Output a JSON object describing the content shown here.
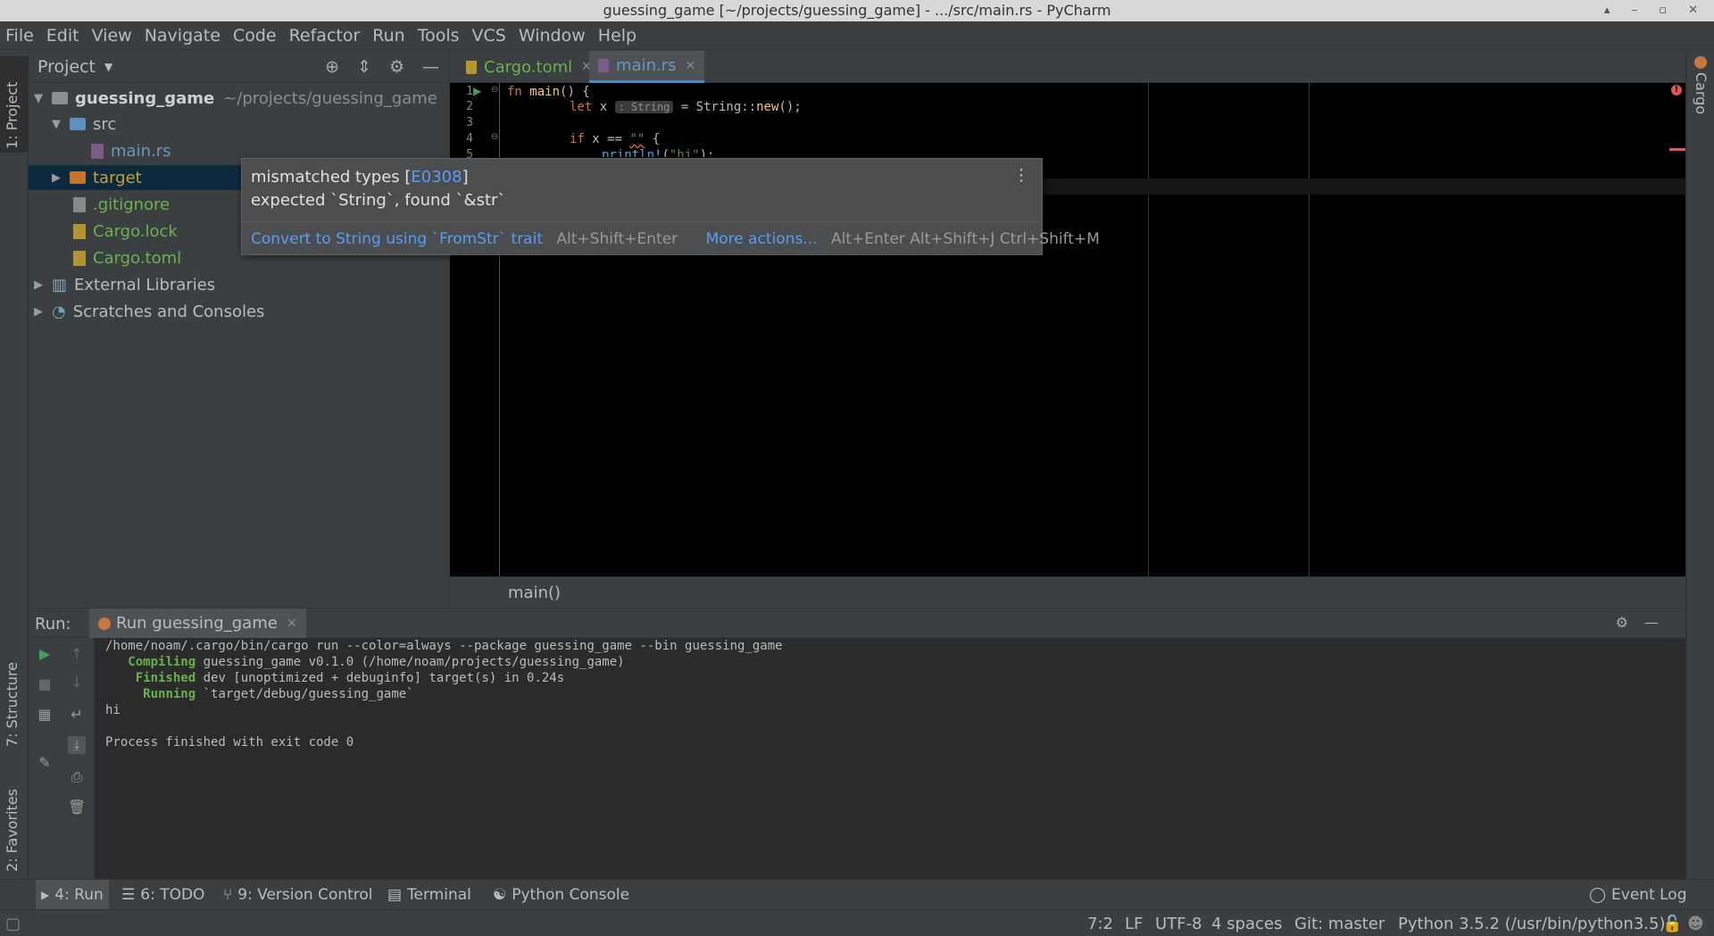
{
  "window": {
    "title": "guessing_game [~/projects/guessing_game] - .../src/main.rs - PyCharm"
  },
  "menu": [
    "File",
    "Edit",
    "View",
    "Navigate",
    "Code",
    "Refactor",
    "Run",
    "Tools",
    "VCS",
    "Window",
    "Help"
  ],
  "left_strip": {
    "project": "1: Project",
    "structure": "7: Structure",
    "favorites": "2: Favorites"
  },
  "right_strip": {
    "cargo": "Cargo"
  },
  "project_panel": {
    "title": "Project",
    "tree": {
      "root": "guessing_game",
      "root_path": "~/projects/guessing_game",
      "src": "src",
      "main_rs": "main.rs",
      "target": "target",
      "gitignore": ".gitignore",
      "cargo_lock": "Cargo.lock",
      "cargo_toml": "Cargo.toml",
      "external": "External Libraries",
      "scratches": "Scratches and Consoles"
    }
  },
  "editor": {
    "tabs": {
      "cargo_toml": "Cargo.toml",
      "main_rs": "main.rs"
    },
    "line_numbers": [
      "1",
      "2",
      "3",
      "4",
      "5"
    ],
    "code": {
      "l1_kw": "fn ",
      "l1_fn": "main",
      "l1_rest": "() {",
      "l2_kw": "let ",
      "l2_var": "x",
      "l2_hint": ": String",
      "l2_rest": " = String::",
      "l2_fn": "new",
      "l2_end": "();",
      "l4_kw": "if ",
      "l4_rest": "x == ",
      "l4_str": "\"\"",
      "l4_end": " {",
      "l5_mac": "println!",
      "l5_rest": "(",
      "l5_str": "\"hi\"",
      "l5_end": ");"
    },
    "breadcrumb": "main()"
  },
  "popup": {
    "title": "mismatched types [",
    "code": "E0308",
    "title_end": "]",
    "message": "expected `String`, found `&str`",
    "action": "Convert to String using `FromStr` trait",
    "action_shortcut": "Alt+Shift+Enter",
    "more": "More actions...",
    "more_shortcut": "Alt+Enter Alt+Shift+J Ctrl+Shift+M"
  },
  "run_panel": {
    "label": "Run:",
    "tab": "Run guessing_game",
    "console": {
      "cmd": "/home/noam/.cargo/bin/cargo run --color=always --package guessing_game --bin guessing_game",
      "compiling_kw": "Compiling",
      "compiling_rest": " guessing_game v0.1.0 (/home/noam/projects/guessing_game)",
      "finished_kw": "Finished",
      "finished_rest": " dev [unoptimized + debuginfo] target(s) in 0.24s",
      "running_kw": "Running",
      "running_rest": " `target/debug/guessing_game`",
      "output": "hi",
      "exit": "Process finished with exit code 0"
    }
  },
  "bottom_tabs": {
    "run": "4: Run",
    "todo": "6: TODO",
    "vcs": "9: Version Control",
    "terminal": "Terminal",
    "python_console": "Python Console",
    "event_log": "Event Log"
  },
  "status": {
    "position": "7:2",
    "line_sep": "LF",
    "encoding": "UTF-8",
    "indent": "4 spaces",
    "git": "Git: master",
    "interpreter": "Python 3.5.2 (/usr/bin/python3.5)"
  },
  "colors": {
    "accent": "#4a88c7",
    "link": "#589df6",
    "error": "#e05555",
    "target_folder": "#c6a030",
    "file_green": "#6ab04c"
  }
}
